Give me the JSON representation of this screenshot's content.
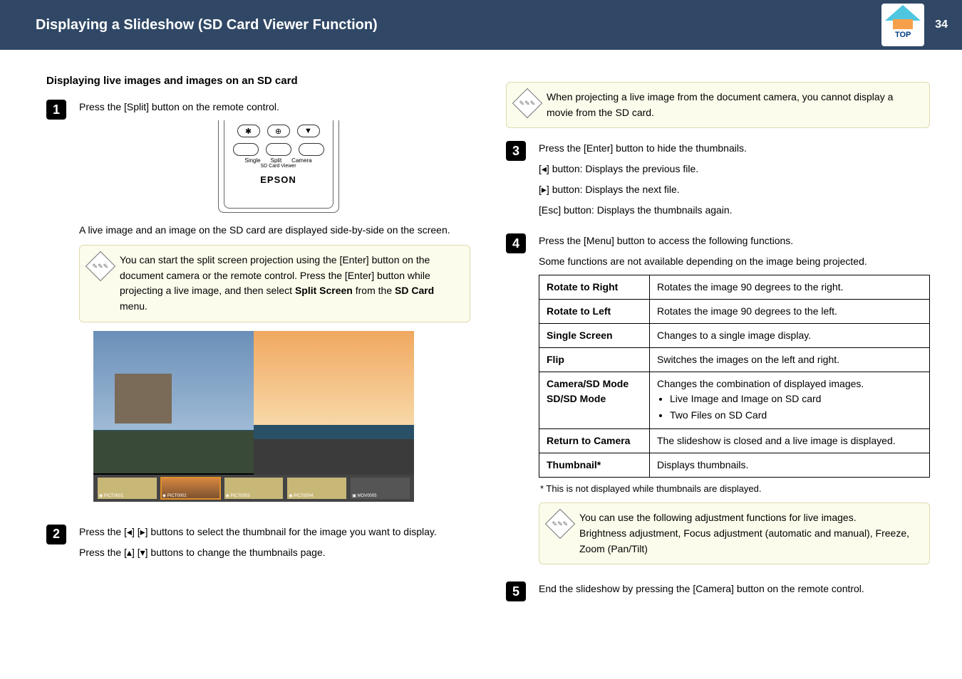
{
  "header": {
    "title": "Displaying a Slideshow (SD Card Viewer Function)",
    "page_number": "34",
    "top_label": "TOP"
  },
  "section_heading": "Displaying live images and images on an SD card",
  "remote": {
    "single": "Single",
    "split": "Split",
    "camera": "Camera",
    "sd_viewer": "SD Card Viewer",
    "brand": "EPSON"
  },
  "steps": {
    "s1": {
      "num": "1",
      "intro": "Press the [Split] button on the remote control.",
      "after_illust": "A live image and an image on the SD card are displayed side-by-side on the screen."
    },
    "note1": {
      "text_a": "You can start the split screen projection using the [Enter] button on the document camera or the remote control. Press the [Enter] button while projecting a live image, and then select ",
      "bold1": "Split Screen",
      "mid": " from the ",
      "bold2": "SD Card",
      "tail": " menu."
    },
    "s2": {
      "num": "2",
      "line1_a": "Press the [",
      "line1_b": "] [",
      "line1_c": "] buttons to select the thumbnail for the image you want to display.",
      "line2_a": "Press the [",
      "line2_b": "] [",
      "line2_c": "] buttons to change the thumbnails page."
    },
    "note_top_right": "When projecting a live image from the document camera, you cannot display a movie from the SD card.",
    "s3": {
      "num": "3",
      "intro": "Press the [Enter] button to hide the thumbnails.",
      "l1_a": "[",
      "l1_b": "] button: Displays the previous file.",
      "l2_a": "[",
      "l2_b": "] button: Displays the next file.",
      "l3": "[Esc] button: Displays the thumbnails again."
    },
    "s4": {
      "num": "4",
      "intro": "Press the [Menu] button to access the following functions.",
      "sub": "Some functions are not available depending on the image being projected."
    },
    "table": {
      "r1": {
        "k": "Rotate to Right",
        "v": "Rotates the image 90 degrees to the right."
      },
      "r2": {
        "k": "Rotate to Left",
        "v": "Rotates the image 90 degrees to the left."
      },
      "r3": {
        "k": "Single Screen",
        "v": "Changes to a single image display."
      },
      "r4": {
        "k": "Flip",
        "v": "Switches the images on the left and right."
      },
      "r5": {
        "k1": "Camera/SD Mode",
        "k2": "SD/SD Mode",
        "v_intro": "Changes the combination of displayed images.",
        "b1": "Live Image and Image on SD card",
        "b2": "Two Files on SD Card"
      },
      "r6": {
        "k": "Return to Camera",
        "v": "The slideshow is closed and a live image is displayed."
      },
      "r7": {
        "k": "Thumbnail*",
        "v": "Displays thumbnails."
      }
    },
    "footnote": "* This is not displayed while thumbnails are displayed.",
    "note3": {
      "l1": "You can use the following adjustment functions for live images.",
      "l2": "Brightness adjustment, Focus adjustment (automatic and manual), Freeze, Zoom (Pan/Tilt)"
    },
    "s5": {
      "num": "5",
      "text": "End the slideshow by pressing the [Camera] button on the remote control."
    }
  },
  "thumbs": {
    "t1": "PICT0001",
    "t2": "PICT0002",
    "t3": "PICT0003",
    "t4": "PICT0004",
    "t5": "MOV0005"
  }
}
